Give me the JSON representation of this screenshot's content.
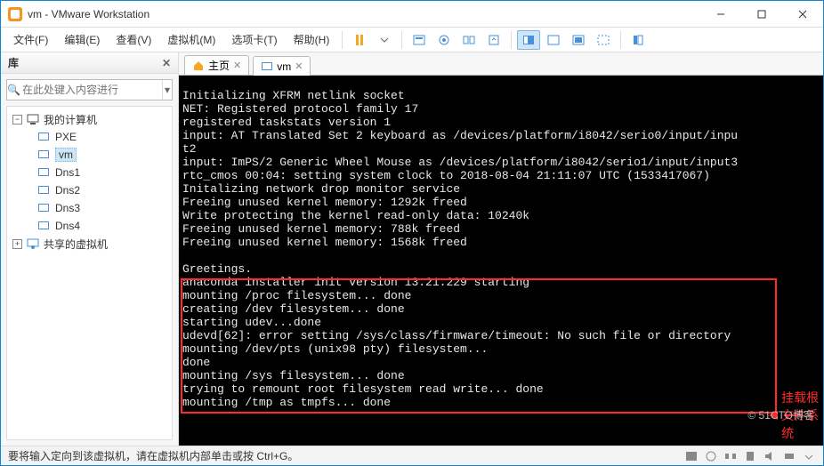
{
  "titlebar": {
    "title": "vm - VMware Workstation"
  },
  "menu": {
    "items": [
      "文件(F)",
      "编辑(E)",
      "查看(V)",
      "虚拟机(M)",
      "选项卡(T)",
      "帮助(H)"
    ]
  },
  "sidebar": {
    "header": "库",
    "search_placeholder": "在此处键入内容进行",
    "root": "我的计算机",
    "vms": [
      "PXE",
      "vm",
      "Dns1",
      "Dns2",
      "Dns3",
      "Dns4"
    ],
    "shared": "共享的虚拟机",
    "selected": "vm"
  },
  "tabs": {
    "items": [
      {
        "label": "主页",
        "icon": "home-icon",
        "closable": true,
        "active": false
      },
      {
        "label": "vm",
        "icon": "vm-icon",
        "closable": true,
        "active": true
      }
    ]
  },
  "console_lines": [
    "Initializing XFRM netlink socket",
    "NET: Registered protocol family 17",
    "registered taskstats version 1",
    "input: AT Translated Set 2 keyboard as /devices/platform/i8042/serio0/input/inpu",
    "t2",
    "input: ImPS/2 Generic Wheel Mouse as /devices/platform/i8042/serio1/input/input3",
    "rtc_cmos 00:04: setting system clock to 2018-08-04 21:11:07 UTC (1533417067)",
    "Initalizing network drop monitor service",
    "Freeing unused kernel memory: 1292k freed",
    "Write protecting the kernel read-only data: 10240k",
    "Freeing unused kernel memory: 788k freed",
    "Freeing unused kernel memory: 1568k freed",
    "",
    "Greetings.",
    "anaconda installer init version 13.21.229 starting",
    "mounting /proc filesystem... done",
    "creating /dev filesystem... done",
    "starting udev...done",
    "udevd[62]: error setting /sys/class/firmware/timeout: No such file or directory",
    "mounting /dev/pts (unix98 pty) filesystem...",
    "done",
    "mounting /sys filesystem... done",
    "trying to remount root filesystem read write... done",
    "mounting /tmp as tmpfs... done"
  ],
  "annotation": {
    "label": "挂载根文件系统"
  },
  "statusbar": {
    "text": "要将输入定向到该虚拟机，请在虚拟机内部单击或按 Ctrl+G。"
  },
  "watermark": "© 51CTO博客"
}
